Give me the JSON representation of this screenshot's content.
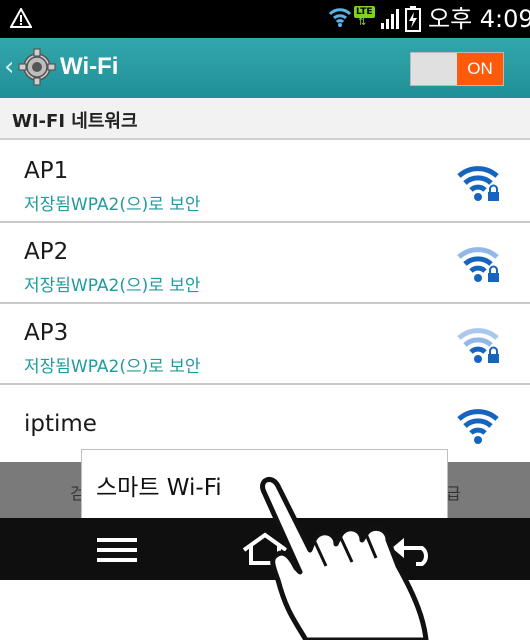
{
  "status_bar": {
    "time": "오후 4:09",
    "network": "LTE"
  },
  "header": {
    "title": "Wi-Fi",
    "toggle_label": "ON"
  },
  "section": {
    "title": "WI-FI 네트워크"
  },
  "networks": [
    {
      "name": "AP1",
      "status": "저장됨WPA2(으)로 보안",
      "signal": "full",
      "locked": true
    },
    {
      "name": "AP2",
      "status": "저장됨WPA2(으)로 보안",
      "signal": "medium",
      "locked": true
    },
    {
      "name": "AP3",
      "status": "저장됨WPA2(으)로 보안",
      "signal": "weak",
      "locked": true
    },
    {
      "name": "iptime",
      "status": "",
      "signal": "full",
      "locked": false
    }
  ],
  "background_buttons": {
    "left": "검",
    "right": "급"
  },
  "popup": {
    "item": "스마트 Wi-Fi"
  },
  "colors": {
    "accent": "#1f8f96",
    "toggle_on": "#ff5a0a",
    "wifi_strong": "#1565c0",
    "subtitle": "#1e9aa0"
  },
  "icons": [
    "warning-icon",
    "wifi-status-icon",
    "signal-icon",
    "battery-icon",
    "settings-gear-icon",
    "wifi-signal-icon",
    "lock-icon",
    "menu-icon",
    "home-icon",
    "back-icon",
    "hand-pointer-icon"
  ]
}
